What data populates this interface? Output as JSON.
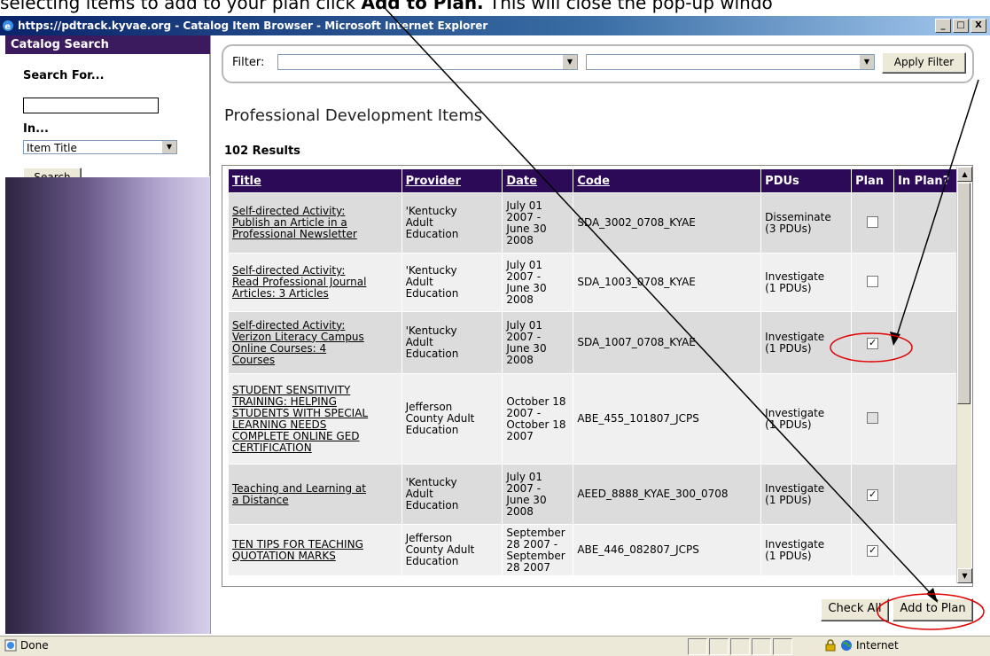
{
  "caption": {
    "text_before": "selecting items to add to your plan click ",
    "bold": "Add to Plan.",
    "text_after": "  This will close the pop-up windo"
  },
  "window": {
    "title": "https://pdtrack.kyvae.org - Catalog Item Browser - Microsoft Internet Explorer",
    "min": "_",
    "max": "□",
    "close": "X"
  },
  "sidebar": {
    "header": "Catalog Search",
    "search_for_label": "Search For...",
    "search_value": "",
    "in_label": "In...",
    "in_selected": "Item Title",
    "search_button": "Search"
  },
  "filter": {
    "label": "Filter:",
    "dropdown1_value": "",
    "dropdown2_value": "",
    "apply_button": "Apply Filter"
  },
  "page_title": "Professional Development Items",
  "results_count": "102 Results",
  "table": {
    "headers": [
      "Title",
      "Provider",
      "Date",
      "Code",
      "PDUs",
      "Plan",
      "In Plan?"
    ],
    "rows": [
      {
        "title": [
          "Self-directed Activity:",
          "Publish an Article in a",
          "Professional Newsletter"
        ],
        "provider": [
          "'Kentucky",
          "Adult",
          "Education"
        ],
        "date": [
          "July 01",
          "2007 -",
          "June 30",
          "2008"
        ],
        "code": "SDA_3002_0708_KYAE",
        "pdus": [
          "Disseminate",
          "(3 PDUs)"
        ],
        "plan": "unchecked"
      },
      {
        "title": [
          "Self-directed Activity:",
          "Read Professional Journal",
          "Articles: 3 Articles"
        ],
        "provider": [
          "'Kentucky",
          "Adult",
          "Education"
        ],
        "date": [
          "July 01",
          "2007 -",
          "June 30",
          "2008"
        ],
        "code": "SDA_1003_0708_KYAE",
        "pdus": [
          "Investigate",
          "(1 PDUs)"
        ],
        "plan": "unchecked"
      },
      {
        "title": [
          "Self-directed Activity:",
          "Verizon Literacy Campus",
          "Online Courses: 4",
          "Courses"
        ],
        "provider": [
          "'Kentucky",
          "Adult",
          "Education"
        ],
        "date": [
          "July 01",
          "2007 -",
          "June 30",
          "2008"
        ],
        "code": "SDA_1007_0708_KYAE",
        "pdus": [
          "Investigate",
          "(1 PDUs)"
        ],
        "plan": "checked"
      },
      {
        "title": [
          "STUDENT SENSITIVITY",
          "TRAINING: HELPING",
          "STUDENTS WITH SPECIAL",
          "LEARNING NEEDS",
          "COMPLETE ONLINE GED",
          "CERTIFICATION"
        ],
        "provider": [
          "Jefferson",
          "County Adult",
          "Education"
        ],
        "date": [
          "October 18",
          "2007 -",
          "October 18",
          "2007"
        ],
        "code": "ABE_455_101807_JCPS",
        "pdus": [
          "Investigate",
          "(1 PDUs)"
        ],
        "plan": "disabled"
      },
      {
        "title": [
          "Teaching and Learning at",
          "a Distance"
        ],
        "provider": [
          "'Kentucky",
          "Adult",
          "Education"
        ],
        "date": [
          "July 01",
          "2007 -",
          "June 30",
          "2008"
        ],
        "code": "AEED_8888_KYAE_300_0708",
        "pdus": [
          "Investigate",
          "(1 PDUs)"
        ],
        "plan": "checked"
      },
      {
        "title": [
          "TEN TIPS FOR TEACHING",
          "QUOTATION MARKS"
        ],
        "provider": [
          "Jefferson",
          "County Adult",
          "Education"
        ],
        "date": [
          "September",
          "28 2007 -",
          "September",
          "28 2007"
        ],
        "code": "ABE_446_082807_JCPS",
        "pdus": [
          "Investigate",
          "(1 PDUs)"
        ],
        "plan": "checked"
      }
    ]
  },
  "buttons": {
    "check_all": "Check All",
    "add_to_plan": "Add to Plan"
  },
  "statusbar": {
    "done": "Done",
    "zone": "Internet"
  },
  "colors": {
    "header_purple": "#2c0a57",
    "sidebar_header": "#3b1a5e",
    "annotation_red": "#e00000"
  }
}
